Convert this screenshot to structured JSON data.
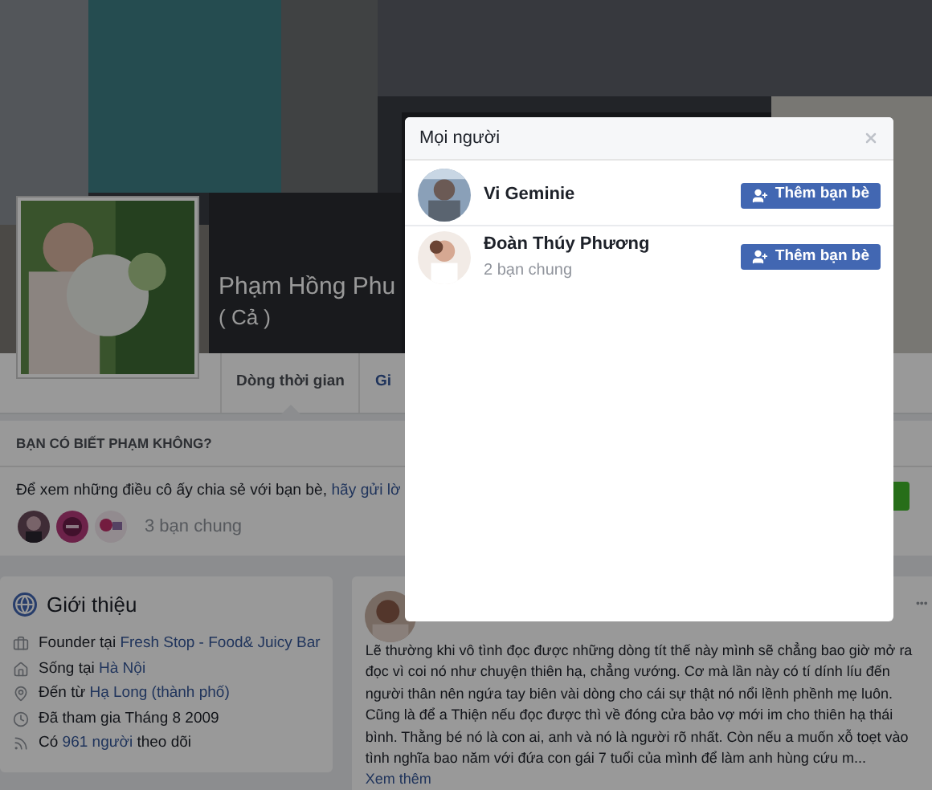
{
  "profile": {
    "name": "Phạm Hồng Phu",
    "nickname": "( Cả )"
  },
  "tabs": [
    {
      "label": "Dòng thời gian",
      "selected": true
    },
    {
      "label": "Gi",
      "selected": false
    }
  ],
  "know_card": {
    "title": "BẠN CÓ BIẾT PHẠM KHÔNG?",
    "text": "Để xem những điều cô ấy chia sẻ với bạn bè,",
    "link": "hãy gửi lờ",
    "mutual": "3 bạn chung"
  },
  "intro": {
    "title": "Giới thiệu",
    "items": [
      {
        "kind": "work",
        "parts": [
          {
            "text": "Founder tại",
            "link": false
          },
          {
            "text": "Fresh Stop - Food& Juicy Bar",
            "link": true
          }
        ]
      },
      {
        "kind": "home",
        "parts": [
          {
            "text": "Sống tại",
            "link": false
          },
          {
            "text": "Hà Nội",
            "link": true
          }
        ]
      },
      {
        "kind": "place",
        "parts": [
          {
            "text": "Đến từ",
            "link": false
          },
          {
            "text": "Hạ Long (thành phố)",
            "link": true
          }
        ]
      },
      {
        "kind": "joined",
        "parts": [
          {
            "text": "Đã tham gia Tháng 8 2009",
            "link": false
          }
        ]
      },
      {
        "kind": "followers",
        "parts": [
          {
            "text": "Có",
            "link": false
          },
          {
            "text": "961 người",
            "link": true
          },
          {
            "text": "theo dõi",
            "link": false
          }
        ]
      }
    ]
  },
  "post": {
    "menu": "•••",
    "text": "Lẽ thường khi vô tình đọc được những dòng tít thế này mình sẽ chẳng bao giờ mở ra đọc vì coi nó như chuyện thiên hạ, chẳng vướng. Cơ mà lần này có tí dính líu đến người thân nên ngứa tay biên vài dòng cho cái sự thật nó nổi lềnh phềnh mẹ luôn. Cũng là để a Thiện nếu đọc được thì về đóng cửa bảo vợ mới im cho thiên hạ thái bình. Thằng bé nó là con ai, anh và nó là người rõ nhất. Còn nếu a muốn xỗ toẹt vào tình nghĩa bao năm với đứa con gái 7 tuổi của mình để làm anh hùng cứu m...",
    "more": "Xem thêm"
  },
  "dialog": {
    "title": "Mọi người",
    "people": [
      {
        "name": "Vi Geminie",
        "button": "Thêm bạn bè"
      },
      {
        "name": "Đoàn Thúy Phương",
        "detail": "2 bạn chung",
        "button": "Thêm bạn bè"
      }
    ]
  }
}
